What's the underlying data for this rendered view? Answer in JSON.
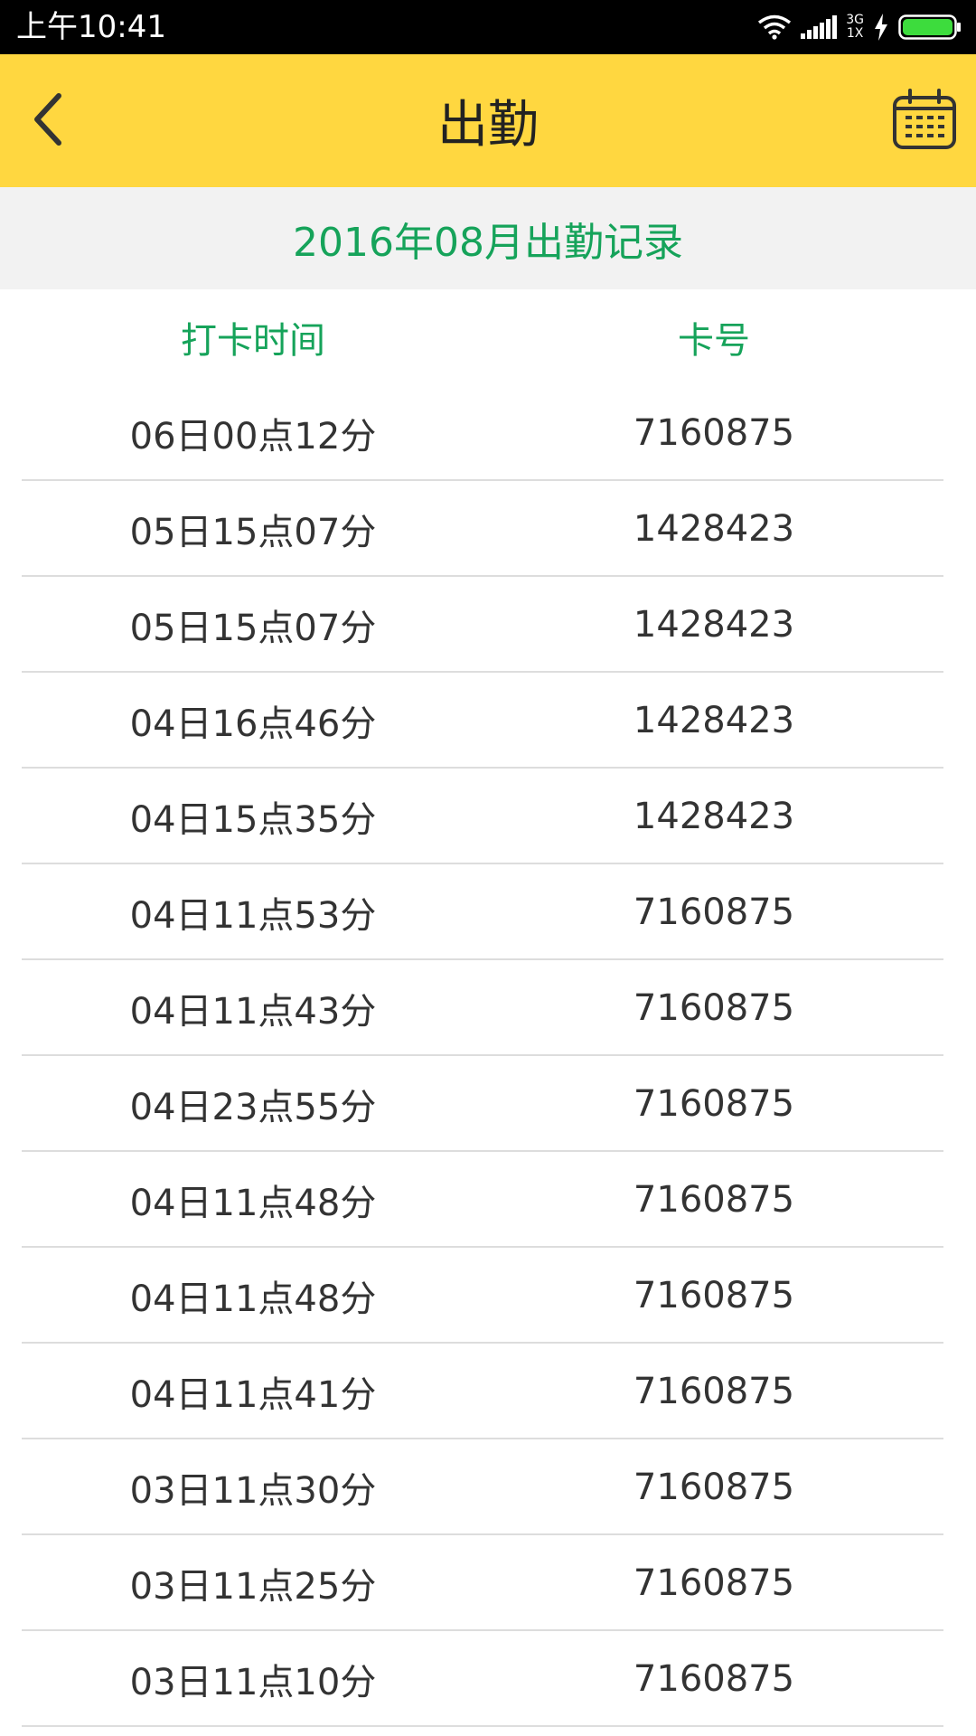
{
  "status_bar": {
    "time": "上午10:41",
    "network_top": "3G",
    "network_bottom": "1X"
  },
  "app_bar": {
    "title": "出勤",
    "back_icon": "chevron-left-icon",
    "calendar_icon": "calendar-icon"
  },
  "month_title": "2016年08月出勤记录",
  "columns": {
    "time": "打卡时间",
    "card": "卡号"
  },
  "records": [
    {
      "time": "06日00点12分",
      "card": "7160875"
    },
    {
      "time": "05日15点07分",
      "card": "1428423"
    },
    {
      "time": "05日15点07分",
      "card": "1428423"
    },
    {
      "time": "04日16点46分",
      "card": "1428423"
    },
    {
      "time": "04日15点35分",
      "card": "1428423"
    },
    {
      "time": "04日11点53分",
      "card": "7160875"
    },
    {
      "time": "04日11点43分",
      "card": "7160875"
    },
    {
      "time": "04日23点55分",
      "card": "7160875"
    },
    {
      "time": "04日11点48分",
      "card": "7160875"
    },
    {
      "time": "04日11点48分",
      "card": "7160875"
    },
    {
      "time": "04日11点41分",
      "card": "7160875"
    },
    {
      "time": "03日11点30分",
      "card": "7160875"
    },
    {
      "time": "03日11点25分",
      "card": "7160875"
    },
    {
      "time": "03日11点10分",
      "card": "7160875"
    }
  ],
  "colors": {
    "app_bar": "#FFD740",
    "accent_green": "#16A35A",
    "battery_green": "#3DDC3D"
  }
}
